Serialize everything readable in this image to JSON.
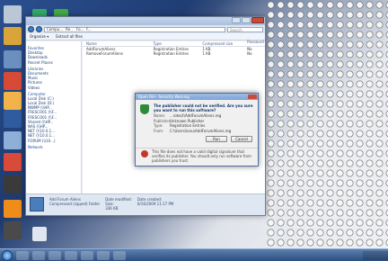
{
  "explorer": {
    "title": "",
    "nav_path": [
      "Compu...",
      "Re...",
      "Fo...",
      "F..."
    ],
    "search_placeholder": "Search",
    "toolbar": {
      "organize": "Organize ▾",
      "extract": "Extract all files"
    },
    "sidebar": {
      "favorites_header": "Favorites",
      "favorites": [
        "Desktop",
        "Downloads",
        "Recent Places"
      ],
      "libraries_header": "Libraries",
      "libraries": [
        "Documents",
        "Music",
        "Pictures",
        "Videos"
      ],
      "computer_header": "Computer",
      "drives": [
        "Local Disk (C:)",
        "Local Disk (D:)",
        "NWMP (\\\\HP...",
        "FRESCO01 (\\\\F...",
        "FRESCO01 (\\\\F...",
        "Shared (\\\\HP...",
        "NAS (\\\\HP...",
        "NET (\\\\10.0.1...",
        "NET (\\\\10.0.1...",
        "FORUM (\\\\10...)"
      ],
      "network_header": "Network"
    },
    "columns": [
      "Name",
      "Type",
      "Compressed size",
      "Password ...",
      "Size",
      "Ratio"
    ],
    "rows": [
      {
        "name": "AddForumAliens",
        "type": "Registration Entries",
        "size": "1 KB",
        "ratio": "No"
      },
      {
        "name": "RemoveForumAliens",
        "type": "Registration Entries",
        "size": "1 KB",
        "ratio": "No"
      }
    ],
    "details": {
      "name": "Add Forum Aliens",
      "type": "Compressed (zipped) Folder",
      "modified_label": "Date modified:",
      "size_label": "Size:",
      "size": "336 KB",
      "created_label": "Date created:",
      "created": "6/16/2009 11:17 PM"
    }
  },
  "dialog": {
    "title": "Open File - Security Warning",
    "question": "The publisher could not be verified. Are you sure you want to run this software?",
    "fields": [
      {
        "key": "Name:",
        "value": "...rotect\\AddForumAliens.reg"
      },
      {
        "key": "Publisher:",
        "value": "Unknown Publisher"
      },
      {
        "key": "Type:",
        "value": "Registration Entries"
      },
      {
        "key": "From:",
        "value": "C:\\Users\\ionu\\AddForumAliens.reg"
      }
    ],
    "run_button": "Run",
    "cancel_button": "Cancel",
    "warning": "This file does not have a valid digital signature that verifies its publisher. You should only run software from publishers you trust."
  },
  "taskbar": {
    "items": [
      "start",
      "ie",
      "explorer",
      "media",
      "folder",
      "word",
      "paint",
      "chat",
      "network"
    ]
  },
  "colors": {
    "accent": "#3a7bd5",
    "dialog_title": "#7ea3d6",
    "shield": "#2e8a3a",
    "warning": "#c0392b"
  }
}
